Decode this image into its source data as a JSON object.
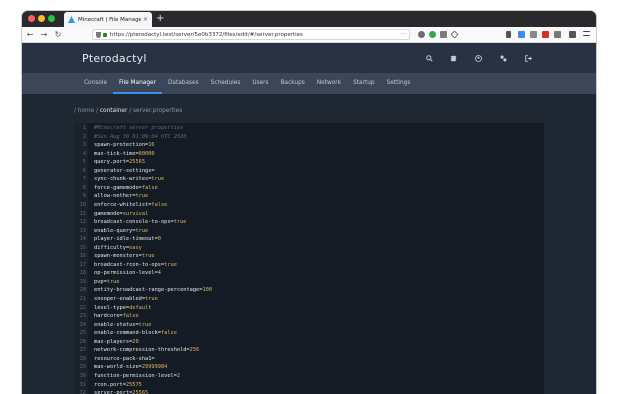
{
  "browser": {
    "tab_title": "Minecraft | File Manager",
    "tab_close": "×",
    "newtab": "+",
    "url": "https://pterodactyl.test/server/5e0b3372/files/edit/#/server.properties",
    "url_more": "···"
  },
  "app": {
    "brand": "Pterodactyl",
    "header_icons": [
      "search-icon",
      "layers-icon",
      "account-icon",
      "settings-icon",
      "logout-icon"
    ]
  },
  "nav": {
    "items": [
      {
        "label": "Console"
      },
      {
        "label": "File Manager"
      },
      {
        "label": "Databases"
      },
      {
        "label": "Schedules"
      },
      {
        "label": "Users"
      },
      {
        "label": "Backups"
      },
      {
        "label": "Network"
      },
      {
        "label": "Startup"
      },
      {
        "label": "Settings"
      }
    ],
    "active_index": 1
  },
  "breadcrumb": {
    "sep": "/",
    "home": "home",
    "container": "container",
    "file": "server.properties"
  },
  "editor": {
    "lines": [
      {
        "n": "1",
        "text": "#Minecraft server properties",
        "comment": true
      },
      {
        "n": "2",
        "text": "#Sun Aug 30 01:09:04 UTC 2020",
        "comment": true
      },
      {
        "n": "3",
        "key": "spawn-protection=",
        "val": "16"
      },
      {
        "n": "4",
        "key": "max-tick-time=",
        "val": "60000"
      },
      {
        "n": "5",
        "key": "query.port=",
        "val": "25565"
      },
      {
        "n": "6",
        "key": "generator-settings=",
        "val": ""
      },
      {
        "n": "7",
        "key": "sync-chunk-writes=",
        "val": "true"
      },
      {
        "n": "8",
        "key": "force-gamemode=",
        "val": "false"
      },
      {
        "n": "9",
        "key": "allow-nether=",
        "val": "true"
      },
      {
        "n": "10",
        "key": "enforce-whitelist=",
        "val": "false"
      },
      {
        "n": "11",
        "key": "gamemode=",
        "val": "survival"
      },
      {
        "n": "12",
        "key": "broadcast-console-to-ops=",
        "val": "true"
      },
      {
        "n": "13",
        "key": "enable-query=",
        "val": "true"
      },
      {
        "n": "14",
        "key": "player-idle-timeout=",
        "val": "0"
      },
      {
        "n": "15",
        "key": "difficulty=",
        "val": "easy"
      },
      {
        "n": "16",
        "key": "spawn-monsters=",
        "val": "true"
      },
      {
        "n": "17",
        "key": "broadcast-rcon-to-ops=",
        "val": "true"
      },
      {
        "n": "18",
        "key": "op-permission-level=",
        "val": "4"
      },
      {
        "n": "19",
        "key": "pvp=",
        "val": "true"
      },
      {
        "n": "20",
        "key": "entity-broadcast-range-percentage=",
        "val": "100"
      },
      {
        "n": "21",
        "key": "snooper-enabled=",
        "val": "true"
      },
      {
        "n": "22",
        "key": "level-type=",
        "val": "default"
      },
      {
        "n": "23",
        "key": "hardcore=",
        "val": "false"
      },
      {
        "n": "24",
        "key": "enable-status=",
        "val": "true"
      },
      {
        "n": "25",
        "key": "enable-command-block=",
        "val": "false"
      },
      {
        "n": "26",
        "key": "max-players=",
        "val": "20"
      },
      {
        "n": "27",
        "key": "network-compression-threshold=",
        "val": "256"
      },
      {
        "n": "28",
        "key": "resource-pack-sha1=",
        "val": ""
      },
      {
        "n": "29",
        "key": "max-world-size=",
        "val": "29999984"
      },
      {
        "n": "30",
        "key": "function-permission-level=",
        "val": "2"
      },
      {
        "n": "31",
        "key": "rcon.port=",
        "val": "25575"
      },
      {
        "n": "32",
        "key": "server-port=",
        "val": "25565"
      }
    ]
  },
  "colors": {
    "accent": "#3a8fe8",
    "value_highlight": "#e0b564"
  }
}
